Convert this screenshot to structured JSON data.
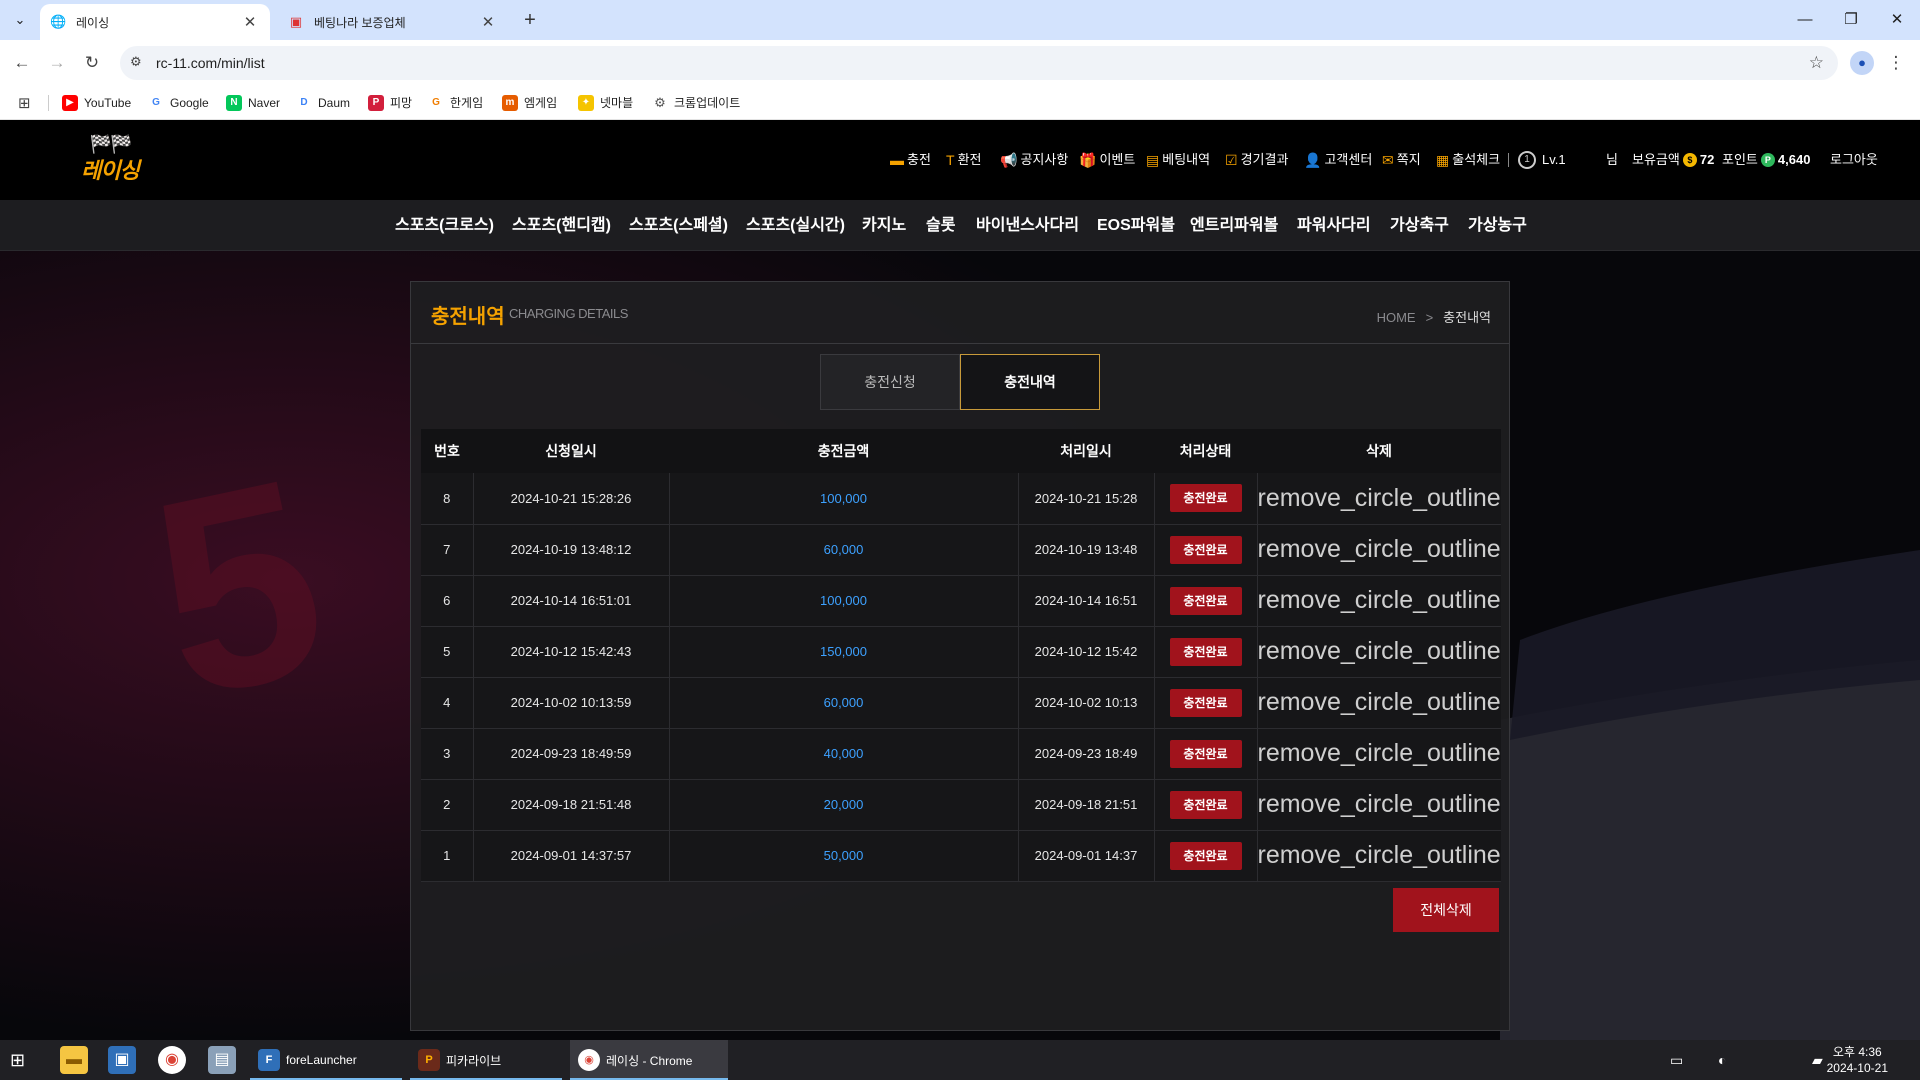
{
  "browser": {
    "tabs": [
      {
        "title": "레이싱",
        "active": true
      },
      {
        "title": "베팅나라 보증업체",
        "active": false
      }
    ],
    "url": "rc-11.com/min/list",
    "bookmarks": [
      {
        "label": "YouTube",
        "icon": "youtube-icon",
        "color": "#ff0000"
      },
      {
        "label": "Google",
        "icon": "google-icon",
        "color": "#4285f4"
      },
      {
        "label": "Naver",
        "icon": "naver-icon",
        "color": "#03c75a"
      },
      {
        "label": "Daum",
        "icon": "daum-icon",
        "color": "#3b82f6"
      },
      {
        "label": "피망",
        "icon": "pmang-icon",
        "color": "#d21f3c"
      },
      {
        "label": "한게임",
        "icon": "hangame-icon",
        "color": "#f07d00"
      },
      {
        "label": "엠게임",
        "icon": "mgame-icon",
        "color": "#e65c00"
      },
      {
        "label": "넷마블",
        "icon": "netmarble-icon",
        "color": "#f5c400"
      },
      {
        "label": "크롬업데이트",
        "icon": "gear-icon",
        "color": "#555555"
      }
    ]
  },
  "site": {
    "logo_text": "레이싱",
    "util_menu": [
      "충전",
      "환전",
      "공지사항",
      "이벤트",
      "베팅내역",
      "경기결과",
      "고객센터",
      "쪽지",
      "출석체크"
    ],
    "level": "Lv.1",
    "user_suffix": "님",
    "balance_label": "보유금액",
    "balance_value": "72",
    "point_label": "포인트",
    "point_value": "4,640",
    "logout_label": "로그아웃",
    "main_nav": [
      "스포츠(크로스)",
      "스포츠(핸디캡)",
      "스포츠(스페셜)",
      "스포츠(실시간)",
      "카지노",
      "슬롯",
      "바이낸스사다리",
      "EOS파워볼",
      "엔트리파워볼",
      "파워사다리",
      "가상축구",
      "가상농구"
    ],
    "accent_color": "#f5a200",
    "danger_color": "#a1131c",
    "amount_color": "#3da1ff"
  },
  "panel": {
    "title": "충전내역",
    "subtitle": "CHARGING DETAILS",
    "breadcrumb_home": "HOME",
    "breadcrumb_sep": ">",
    "breadcrumb_current": "충전내역",
    "tabs": [
      {
        "label": "충전신청",
        "active": false
      },
      {
        "label": "충전내역",
        "active": true
      }
    ],
    "columns": [
      "번호",
      "신청일시",
      "충전금액",
      "처리일시",
      "처리상태",
      "삭제"
    ],
    "rows": [
      {
        "no": "8",
        "requested": "2024-10-21 15:28:26",
        "amount": "100,000",
        "processed": "2024-10-21 15:28",
        "status": "충전완료",
        "delete": "remove_circle_outline"
      },
      {
        "no": "7",
        "requested": "2024-10-19 13:48:12",
        "amount": "60,000",
        "processed": "2024-10-19 13:48",
        "status": "충전완료",
        "delete": "remove_circle_outline"
      },
      {
        "no": "6",
        "requested": "2024-10-14 16:51:01",
        "amount": "100,000",
        "processed": "2024-10-14 16:51",
        "status": "충전완료",
        "delete": "remove_circle_outline"
      },
      {
        "no": "5",
        "requested": "2024-10-12 15:42:43",
        "amount": "150,000",
        "processed": "2024-10-12 15:42",
        "status": "충전완료",
        "delete": "remove_circle_outline"
      },
      {
        "no": "4",
        "requested": "2024-10-02 10:13:59",
        "amount": "60,000",
        "processed": "2024-10-02 10:13",
        "status": "충전완료",
        "delete": "remove_circle_outline"
      },
      {
        "no": "3",
        "requested": "2024-09-23 18:49:59",
        "amount": "40,000",
        "processed": "2024-09-23 18:49",
        "status": "충전완료",
        "delete": "remove_circle_outline"
      },
      {
        "no": "2",
        "requested": "2024-09-18 21:51:48",
        "amount": "20,000",
        "processed": "2024-09-18 21:51",
        "status": "충전완료",
        "delete": "remove_circle_outline"
      },
      {
        "no": "1",
        "requested": "2024-09-01 14:37:57",
        "amount": "50,000",
        "processed": "2024-09-01 14:37",
        "status": "충전완료",
        "delete": "remove_circle_outline"
      }
    ],
    "delete_all_label": "전체삭제"
  },
  "taskbar": {
    "apps": [
      {
        "label": "foreLauncher",
        "icon": "forelauncher-icon"
      },
      {
        "label": "피카라이브",
        "icon": "pikalive-icon"
      },
      {
        "label": "레이싱 - Chrome",
        "icon": "chrome-icon",
        "active": true
      }
    ],
    "clock_time": "오후 4:36",
    "clock_date": "2024-10-21"
  }
}
